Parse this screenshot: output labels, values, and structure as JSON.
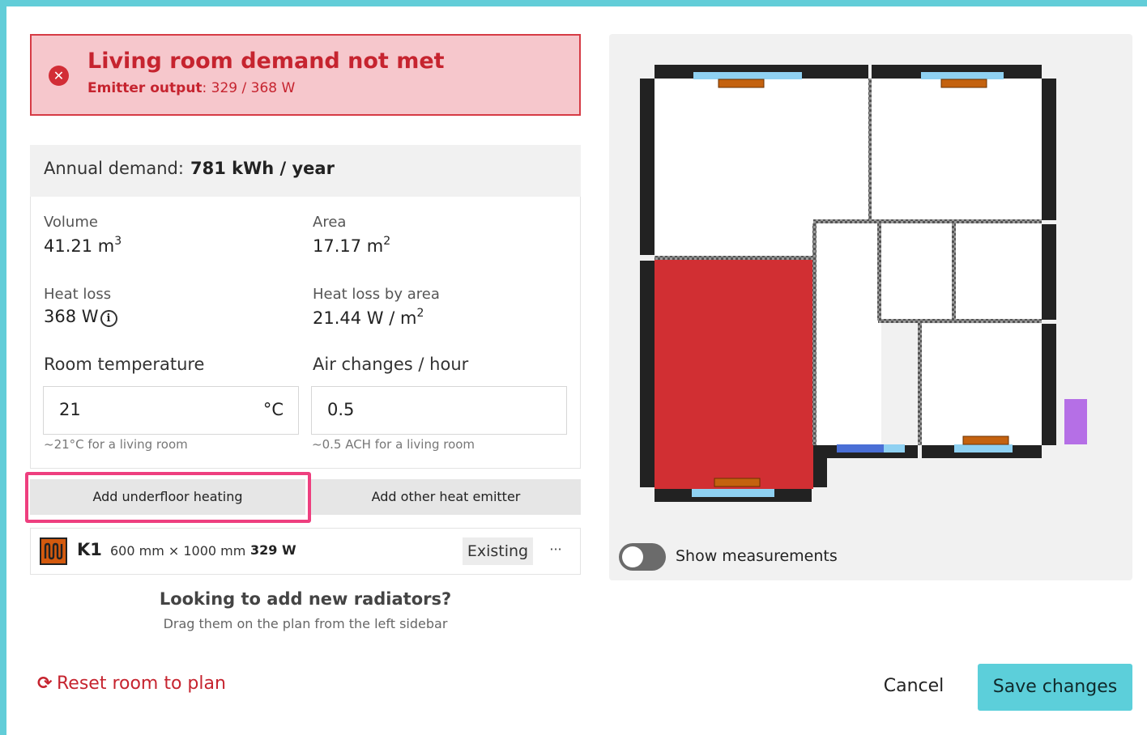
{
  "alert": {
    "title": "Living room demand not met",
    "output_label": "Emitter output",
    "output_value": ": 329 / 368 W",
    "icon": "error-x-icon",
    "color": "#c6242f"
  },
  "summary": {
    "annual_label": "Annual demand:",
    "annual_value": "781 kWh / year"
  },
  "stats": {
    "volume_label": "Volume",
    "volume_value": "41.21 m",
    "volume_unit_sup": "3",
    "area_label": "Area",
    "area_value": "17.17 m",
    "area_unit_sup": "2",
    "heat_loss_label": "Heat loss",
    "heat_loss_value": "368 W",
    "heat_loss_by_area_label": "Heat loss by area",
    "heat_loss_by_area_value": "21.44 W / m",
    "heat_loss_by_area_sup": "2"
  },
  "inputs": {
    "room_temp_label": "Room temperature",
    "room_temp_value": "21",
    "room_temp_unit": "°C",
    "room_temp_hint": "~21°C for a living room",
    "ach_label": "Air changes / hour",
    "ach_value": "0.5",
    "ach_hint": "~0.5 ACH for a living room"
  },
  "actions": {
    "add_underfloor": "Add underfloor heating",
    "add_other": "Add other heat emitter"
  },
  "emitters": [
    {
      "name": "K1",
      "size": "600 mm × 1000 mm",
      "output": "329 W",
      "status": "Existing",
      "menu": "···",
      "icon": "underfloor-heating-icon"
    }
  ],
  "help": {
    "title": "Looking to add new radiators?",
    "subtitle": "Drag them on the plan from the left sidebar"
  },
  "footer": {
    "reset_label": "Reset room to plan",
    "reset_icon": "refresh-icon",
    "cancel_label": "Cancel",
    "save_label": "Save changes"
  },
  "plan": {
    "toggle_label": "Show measurements",
    "toggle_on": false,
    "selected_room_color": "#d12f33",
    "wall_color": "#222222",
    "window_color": "#8fd1f2",
    "emitter_color": "#c4620f",
    "door_color": "#4a6fd6",
    "marker_color": "#b56fe6"
  },
  "colors": {
    "accent": "#5ccfda",
    "highlight_border": "#ee3f7f"
  }
}
